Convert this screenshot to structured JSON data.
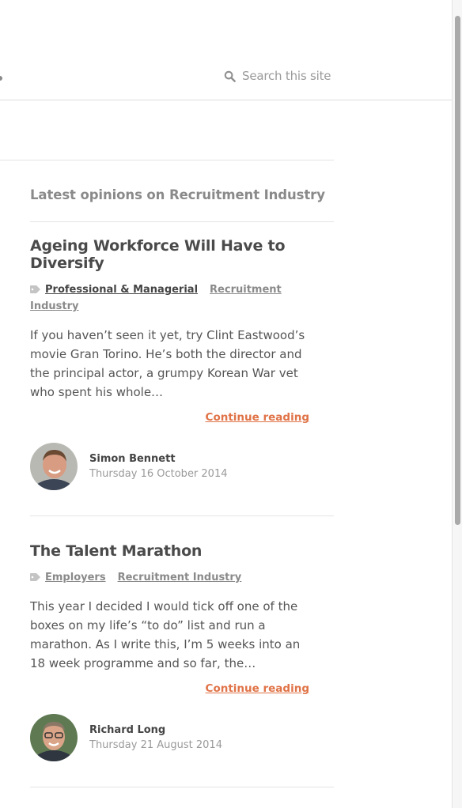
{
  "search": {
    "placeholder": "Search this site"
  },
  "section": {
    "title": "Latest opinions on Recruitment Industry"
  },
  "articles": [
    {
      "title": "Ageing Workforce Will Have to Diversify",
      "tags": [
        "Professional & Managerial",
        "Recruitment Industry"
      ],
      "excerpt": "If you haven’t seen it yet, try Clint Eastwood’s movie Gran Torino. He’s both the director and the principal actor, a grumpy Korean War vet who spent his whole…",
      "continue_label": "Continue reading",
      "author": {
        "name": "Simon Bennett",
        "date": "Thursday 16 October 2014"
      }
    },
    {
      "title": "The Talent Marathon",
      "tags": [
        "Employers",
        "Recruitment Industry"
      ],
      "excerpt": "This year I decided I would tick off one of the boxes on my life’s “to do” list and run a marathon. As I write this, I’m 5 weeks into an 18 week programme and so far, the…",
      "continue_label": "Continue reading",
      "author": {
        "name": "Richard Long",
        "date": "Thursday 21 August 2014"
      }
    }
  ],
  "colors": {
    "accent": "#e07347",
    "text": "#444444",
    "muted": "#9a9a9a",
    "rule": "#e4e4e4"
  }
}
